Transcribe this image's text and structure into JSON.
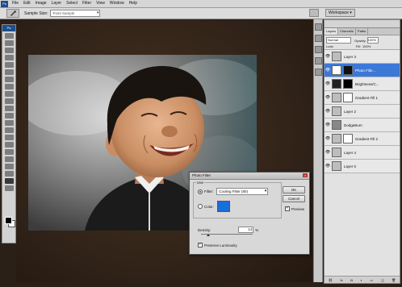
{
  "menubar": {
    "app_icon": "Ps",
    "items": [
      "File",
      "Edit",
      "Image",
      "Layer",
      "Select",
      "Filter",
      "View",
      "Window",
      "Help"
    ]
  },
  "options_bar": {
    "sample_size_label": "Sample Size:",
    "sample_size_value": "Point Sample"
  },
  "workspace": {
    "label": "Workspace ▾"
  },
  "toolbox": {
    "header": "Ps"
  },
  "layers_panel": {
    "tabs": [
      "Layers",
      "Channels",
      "Paths"
    ],
    "blend_mode": "Normal",
    "opacity_label": "Opacity:",
    "opacity_value": "100%",
    "lock_label": "Lock:",
    "fill_label": "Fill:",
    "fill_value": "100%",
    "layers": [
      {
        "name": "Layer 3",
        "selected": false,
        "has_mask": false
      },
      {
        "name": "Photo Filte...",
        "selected": true,
        "has_mask": true
      },
      {
        "name": "Brightness/C...",
        "selected": false,
        "has_mask": true
      },
      {
        "name": "Gradient Fill 1",
        "selected": false,
        "has_mask": true
      },
      {
        "name": "Layer 2",
        "selected": false,
        "has_mask": false
      },
      {
        "name": "DodgeBurn",
        "selected": false,
        "has_mask": false
      },
      {
        "name": "Gradient Fill 2",
        "selected": false,
        "has_mask": true
      },
      {
        "name": "Layer 4",
        "selected": false,
        "has_mask": false
      },
      {
        "name": "Layer 0",
        "selected": false,
        "has_mask": false
      }
    ]
  },
  "dialog": {
    "title": "Photo Filter",
    "use_legend": "Use",
    "filter_label": "Filter:",
    "filter_value": "Cooling Filter (80)",
    "color_label": "Color:",
    "swatch_color": "#1a6ed8",
    "ok_label": "OK",
    "cancel_label": "Cancel",
    "preview_label": "Preview",
    "preview_checked": true,
    "density_label": "Density:",
    "density_value": "14",
    "density_unit": "%",
    "density_fraction": 0.14,
    "preserve_label": "Preserve Luminosity",
    "preserve_checked": true
  }
}
